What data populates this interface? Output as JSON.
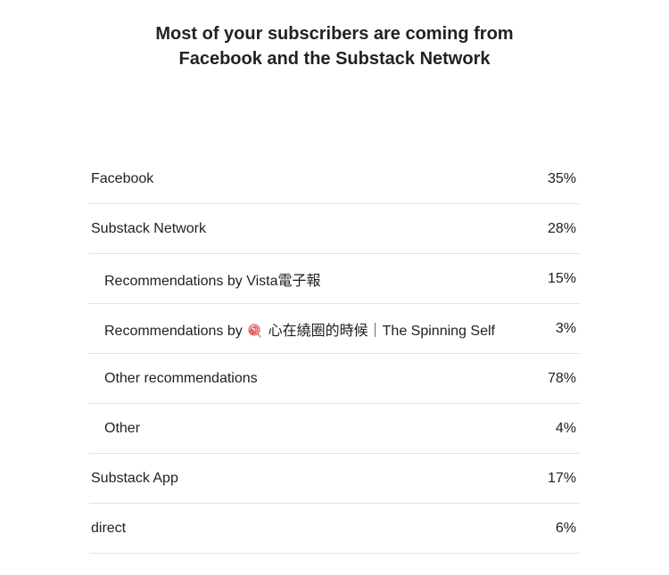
{
  "headline": {
    "line1": "Most of your subscribers are coming from",
    "line2": "Facebook and the Substack Network"
  },
  "sources": [
    {
      "label": "Facebook",
      "value": "35%",
      "indent": false
    },
    {
      "label": "Substack Network",
      "value": "28%",
      "indent": false
    },
    {
      "label": "Recommendations by Vista電子報",
      "value": "15%",
      "indent": true
    },
    {
      "label_prefix": "Recommendations by",
      "label_icon": "lollipop-icon",
      "label_suffix": "心在繞圈的時候｜The Spinning Self",
      "value": "3%",
      "indent": true
    },
    {
      "label": "Other recommendations",
      "value": "78%",
      "indent": true
    },
    {
      "label": "Other",
      "value": "4%",
      "indent": true
    },
    {
      "label": "Substack App",
      "value": "17%",
      "indent": false
    },
    {
      "label": "direct",
      "value": "6%",
      "indent": false
    }
  ]
}
